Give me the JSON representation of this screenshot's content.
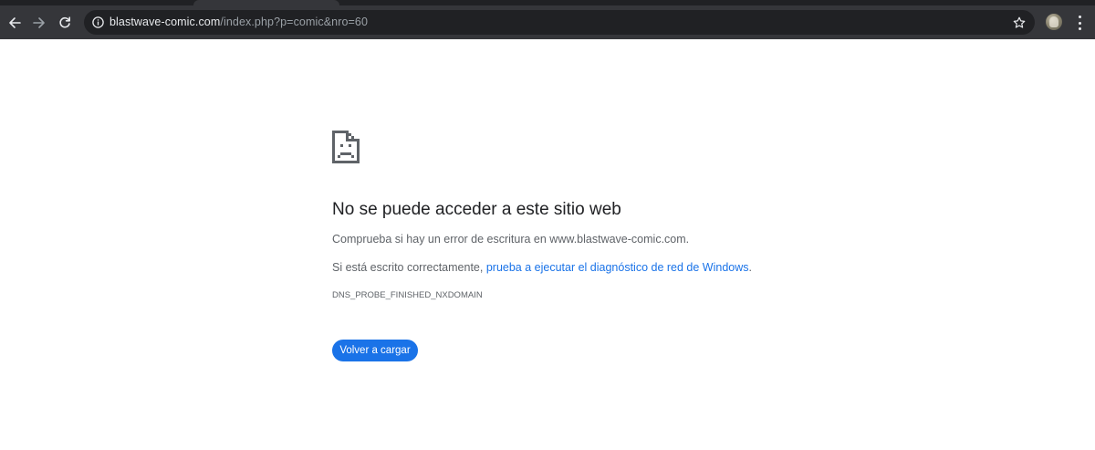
{
  "browser": {
    "url_host": "blastwave-comic.com",
    "url_path": "/index.php?p=comic&nro=60",
    "icons": {
      "back": "back-arrow-icon",
      "forward": "forward-arrow-icon",
      "reload": "reload-icon",
      "site_info": "info-icon",
      "bookmark": "star-icon",
      "menu": "kebab-menu-icon"
    }
  },
  "error_page": {
    "icon": "sad-page-icon",
    "title": "No se puede acceder a este sitio web",
    "check_text": "Comprueba si hay un error de escritura en www.blastwave-comic.com.",
    "spelled_prefix": "Si está escrito correctamente, ",
    "diagnostic_link": "prueba a ejecutar el diagnóstico de red de Windows",
    "spelled_suffix": ".",
    "error_code": "DNS_PROBE_FINISHED_NXDOMAIN",
    "reload_button": "Volver a cargar"
  },
  "colors": {
    "chrome_bg": "#35363a",
    "omnibox_bg": "#202124",
    "accent": "#1a73e8",
    "title_text": "#202124",
    "body_text": "#5f6368"
  }
}
